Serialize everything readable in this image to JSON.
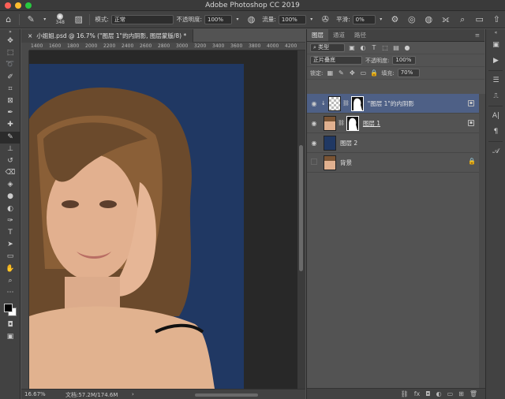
{
  "window": {
    "title": "Adobe Photoshop CC 2019"
  },
  "options_bar": {
    "brush_size": "348",
    "mode_label": "模式:",
    "mode_value": "正常",
    "opacity_label": "不透明度:",
    "opacity_value": "100%",
    "flow_label": "流量:",
    "flow_value": "100%",
    "smoothing_label": "平滑:",
    "smoothing_value": "0%"
  },
  "document": {
    "tab_title": "小姐姐.psd @ 16.7% (\"图层 1\"的内阴影, 图层蒙版/8) *",
    "ruler_ticks": [
      "1400",
      "1600",
      "1800",
      "2000",
      "2200",
      "2400",
      "2600",
      "2800",
      "3000",
      "3200",
      "3400",
      "3600",
      "3800",
      "4000",
      "4200"
    ],
    "zoom": "16.67%",
    "doc_size": "文档:57.2M/174.6M"
  },
  "panel": {
    "tabs": [
      "图层",
      "通道",
      "路径"
    ],
    "filter_kind": "类型",
    "blend_mode": "正片叠底",
    "opacity_label": "不透明度:",
    "opacity_value": "100%",
    "lock_label": "锁定:",
    "fill_label": "填充:",
    "fill_value": "70%",
    "layers": [
      {
        "name": "\"图层 1\"的内阴影"
      },
      {
        "name": "图层 1"
      },
      {
        "name": "图层 2"
      },
      {
        "name": "背景"
      }
    ]
  },
  "colors": {
    "canvas_bg": "#203863",
    "selected_layer": "#4e6086",
    "foreground": "#000000",
    "background": "#ffffff"
  }
}
